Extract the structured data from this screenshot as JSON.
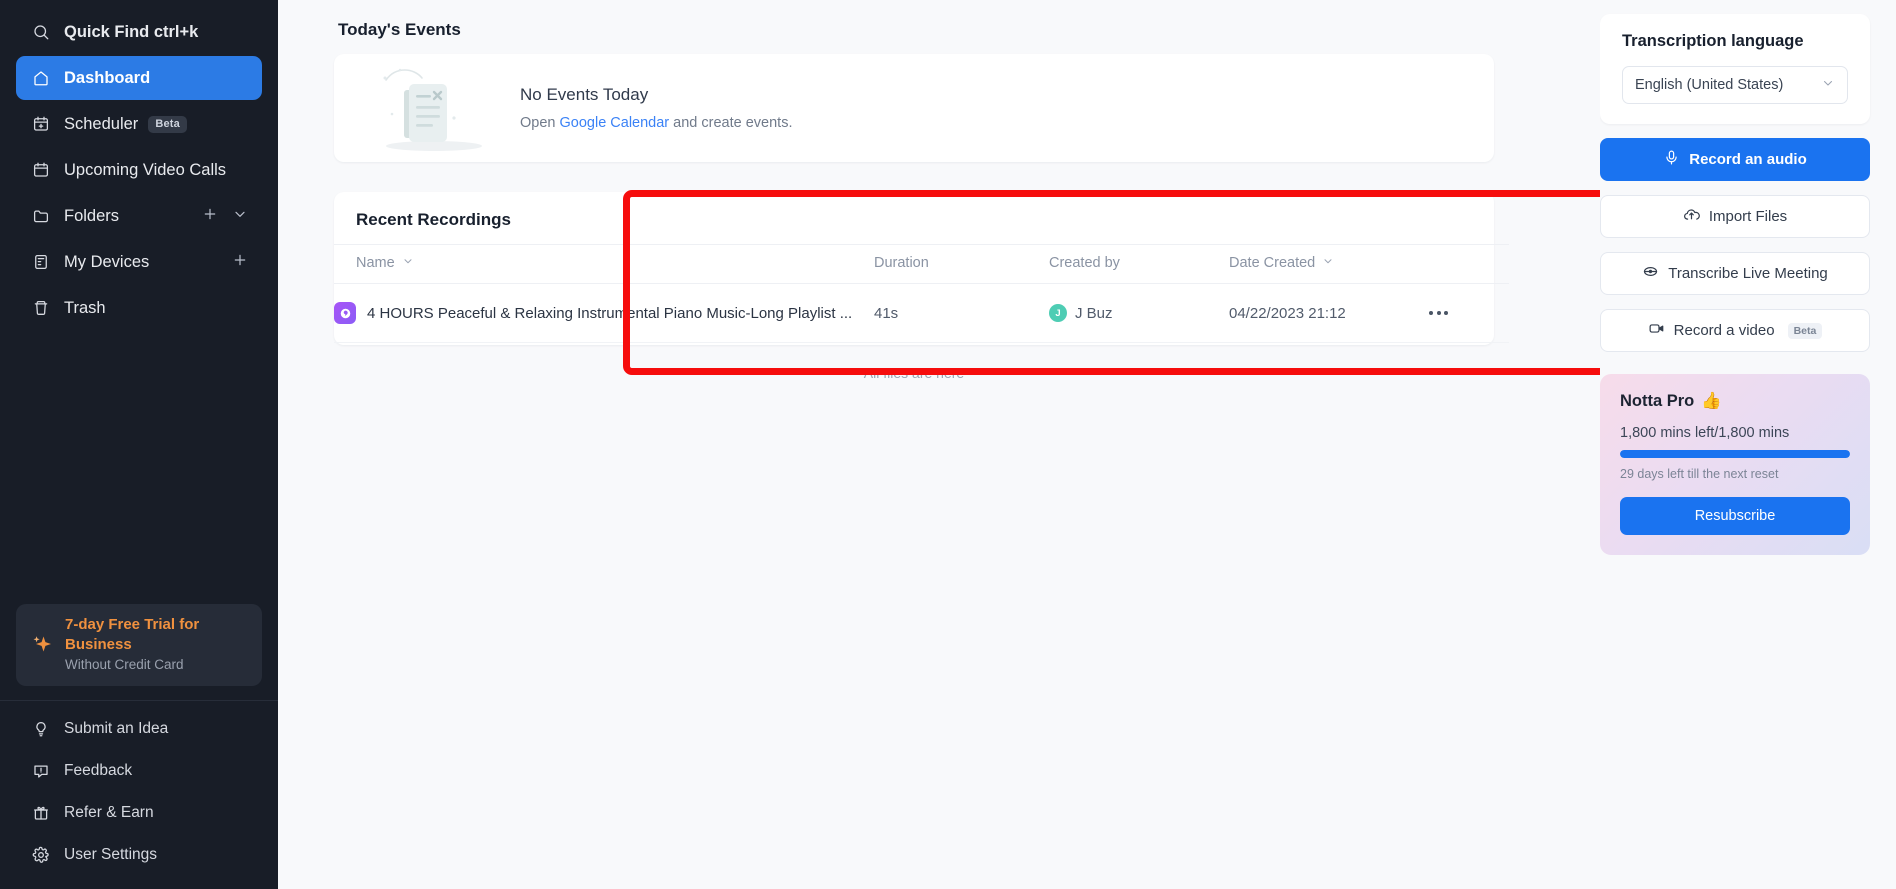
{
  "sidebar": {
    "quick_find": {
      "label": "Quick Find ctrl+k",
      "icon": "search-icon"
    },
    "items": [
      {
        "label": "Dashboard",
        "icon": "home-icon",
        "active": true
      },
      {
        "label": "Scheduler",
        "icon": "calendar-plus-icon",
        "badge": "Beta"
      },
      {
        "label": "Upcoming Video Calls",
        "icon": "calendar-icon"
      },
      {
        "label": "Folders",
        "icon": "folder-icon",
        "actions": [
          "plus-icon",
          "chevron-down-icon"
        ]
      },
      {
        "label": "My Devices",
        "icon": "device-icon",
        "actions": [
          "plus-icon"
        ]
      },
      {
        "label": "Trash",
        "icon": "trash-icon"
      }
    ],
    "trial": {
      "title": "7-day Free Trial for Business",
      "subtitle": "Without Credit Card",
      "icon": "sparkle-icon",
      "title_color": "#f0913f"
    },
    "bottom_items": [
      {
        "label": "Submit an Idea",
        "icon": "lightbulb-icon"
      },
      {
        "label": "Feedback",
        "icon": "message-alert-icon"
      },
      {
        "label": "Refer & Earn",
        "icon": "gift-icon"
      },
      {
        "label": "User Settings",
        "icon": "gear-icon"
      }
    ]
  },
  "main": {
    "events": {
      "section_title": "Today's Events",
      "empty_title": "No Events Today",
      "empty_sub_pre": "Open ",
      "empty_sub_link": "Google Calendar",
      "empty_sub_post": " and create events.",
      "illustration": "empty-document-icon"
    },
    "recordings": {
      "section_title": "Recent Recordings",
      "columns": [
        {
          "key": "name",
          "label": "Name",
          "sortable": true
        },
        {
          "key": "duration",
          "label": "Duration",
          "sortable": false
        },
        {
          "key": "created_by",
          "label": "Created by",
          "sortable": false
        },
        {
          "key": "date_created",
          "label": "Date Created",
          "sortable": true
        }
      ],
      "rows": [
        {
          "name": "4 HOURS Peaceful & Relaxing Instrumental Piano Music-Long Playlist ...",
          "duration": "41s",
          "created_by": "J Buz",
          "created_by_initial": "J",
          "date_created": "04/22/2023 21:12",
          "file_icon": "notta-file-icon"
        }
      ],
      "footer_text": "All files are here"
    },
    "highlight": {
      "color": "#f60d0d"
    }
  },
  "rightbar": {
    "language": {
      "title": "Transcription language",
      "selected": "English (United States)"
    },
    "actions": [
      {
        "label": "Record an audio",
        "icon": "microphone-icon",
        "primary": true
      },
      {
        "label": "Import Files",
        "icon": "cloud-upload-icon",
        "primary": false
      },
      {
        "label": "Transcribe Live Meeting",
        "icon": "live-meeting-icon",
        "primary": false
      },
      {
        "label": "Record a video",
        "icon": "video-camera-icon",
        "primary": false,
        "badge": "Beta"
      }
    ],
    "pro": {
      "title": "Notta Pro",
      "emoji": "👍",
      "minutes": "1,800 mins left/1,800 mins",
      "progress_percent": 100,
      "reset_note": "29 days left till the next reset",
      "button": "Resubscribe",
      "accent": "#1a73f0"
    }
  }
}
